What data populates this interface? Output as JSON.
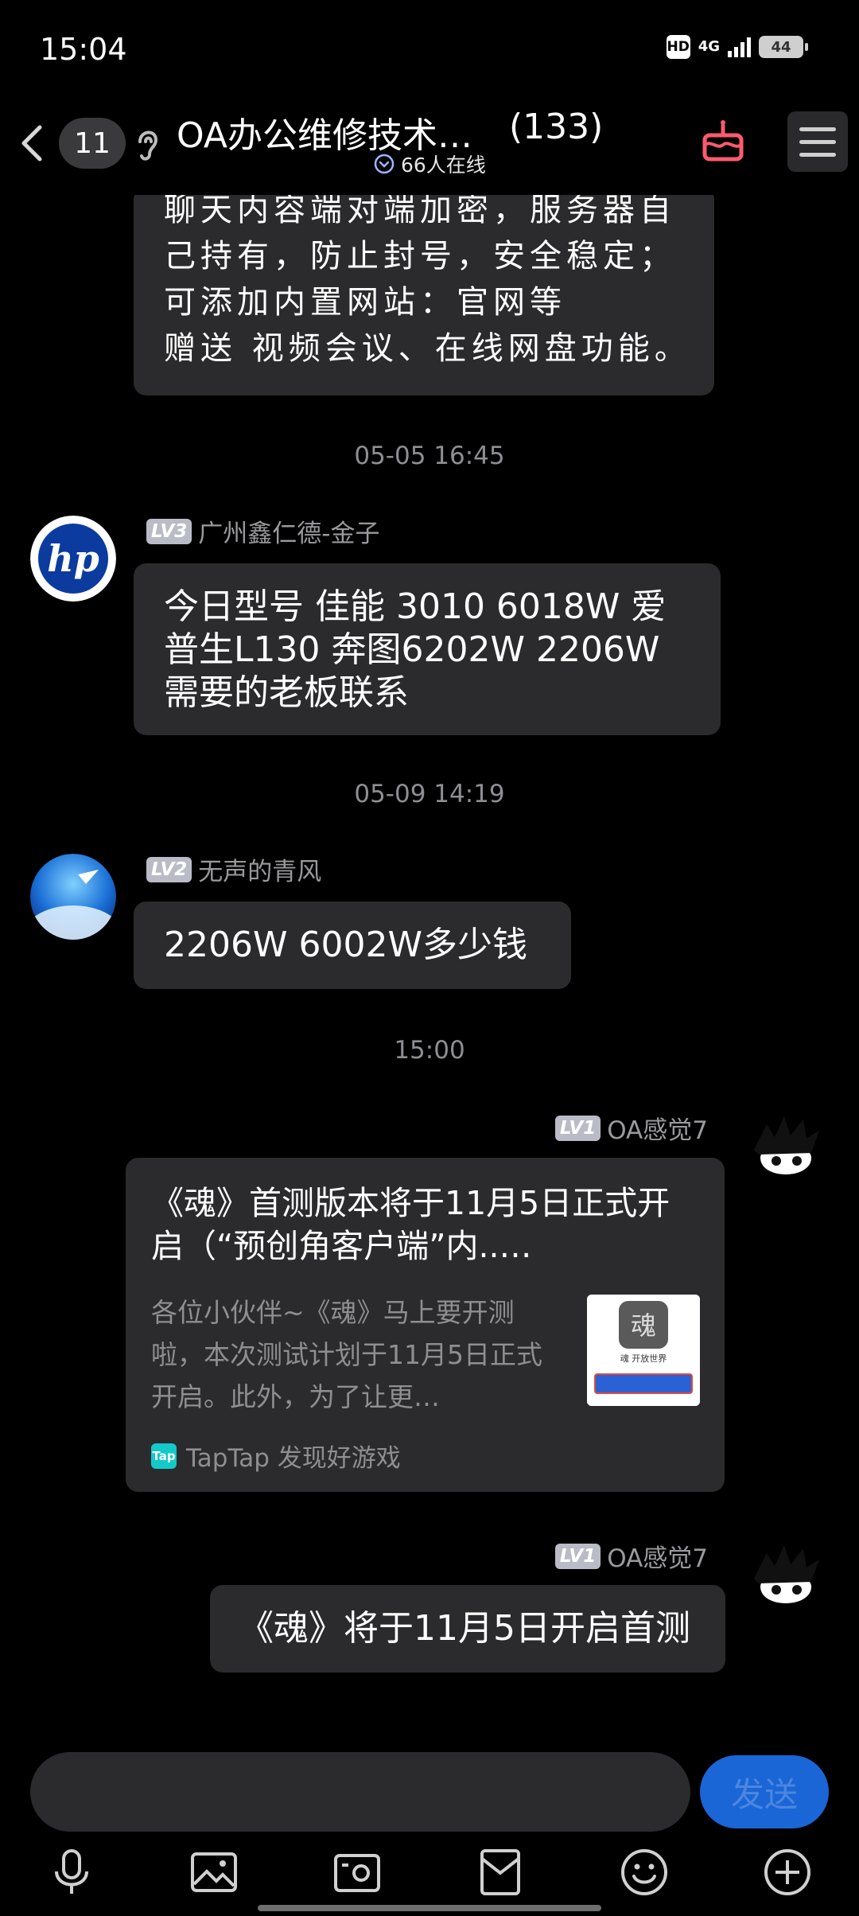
{
  "status_bar": {
    "time": "15:04",
    "hd": "HD",
    "network": "4G",
    "battery": "44"
  },
  "header": {
    "unread_count": "11",
    "title": "OA办公维修技术…",
    "member_count": "(133)",
    "online": "66人在线"
  },
  "messages": {
    "m1": {
      "lines": [
        "聊天内容端对端加密，服务器自",
        "己持有，防止封号，安全稳定；",
        "可添加内置网站：官网等",
        "赠送 视频会议、在线网盘功能。"
      ]
    },
    "ts1": "05-05 16:45",
    "m2": {
      "level": "LV3",
      "sender": "广州鑫仁德-金子",
      "text": "今日型号 佳能 3010  6018W  爱普生L130  奔图6202W  2206W  需要的老板联系"
    },
    "ts2": "05-09 14:19",
    "m3": {
      "level": "LV2",
      "sender": "无声的青风",
      "text": "2206W  6002W多少钱"
    },
    "ts3": "15:00",
    "m4": {
      "level": "LV1",
      "sender": "OA感觉7",
      "card_title": "《魂》首测版本将于11月5日正式开启（“预创角客户端”内..…",
      "card_desc": "各位小伙伴~《魂》马上要开测啦，本次测试计划于11月5日正式开启。此外，为了让更…",
      "thumb_caption": "魂 开放世界",
      "source": "TapTap 发现好游戏",
      "source_icon": "Tap"
    },
    "m5": {
      "level": "LV1",
      "sender": "OA感觉7",
      "text": "《魂》将于11月5日开启首测"
    }
  },
  "input": {
    "placeholder": "",
    "send_label": "发送"
  },
  "toolbar": {
    "items": [
      "microphone-icon",
      "image-icon",
      "camera-icon",
      "red-packet-icon",
      "emoji-icon",
      "plus-icon"
    ]
  },
  "colors": {
    "bubble": "#2b2b2d",
    "send_button": "#1a66d6",
    "muted_text": "#8e8e93",
    "accent_cake": "#ff5a6e"
  }
}
